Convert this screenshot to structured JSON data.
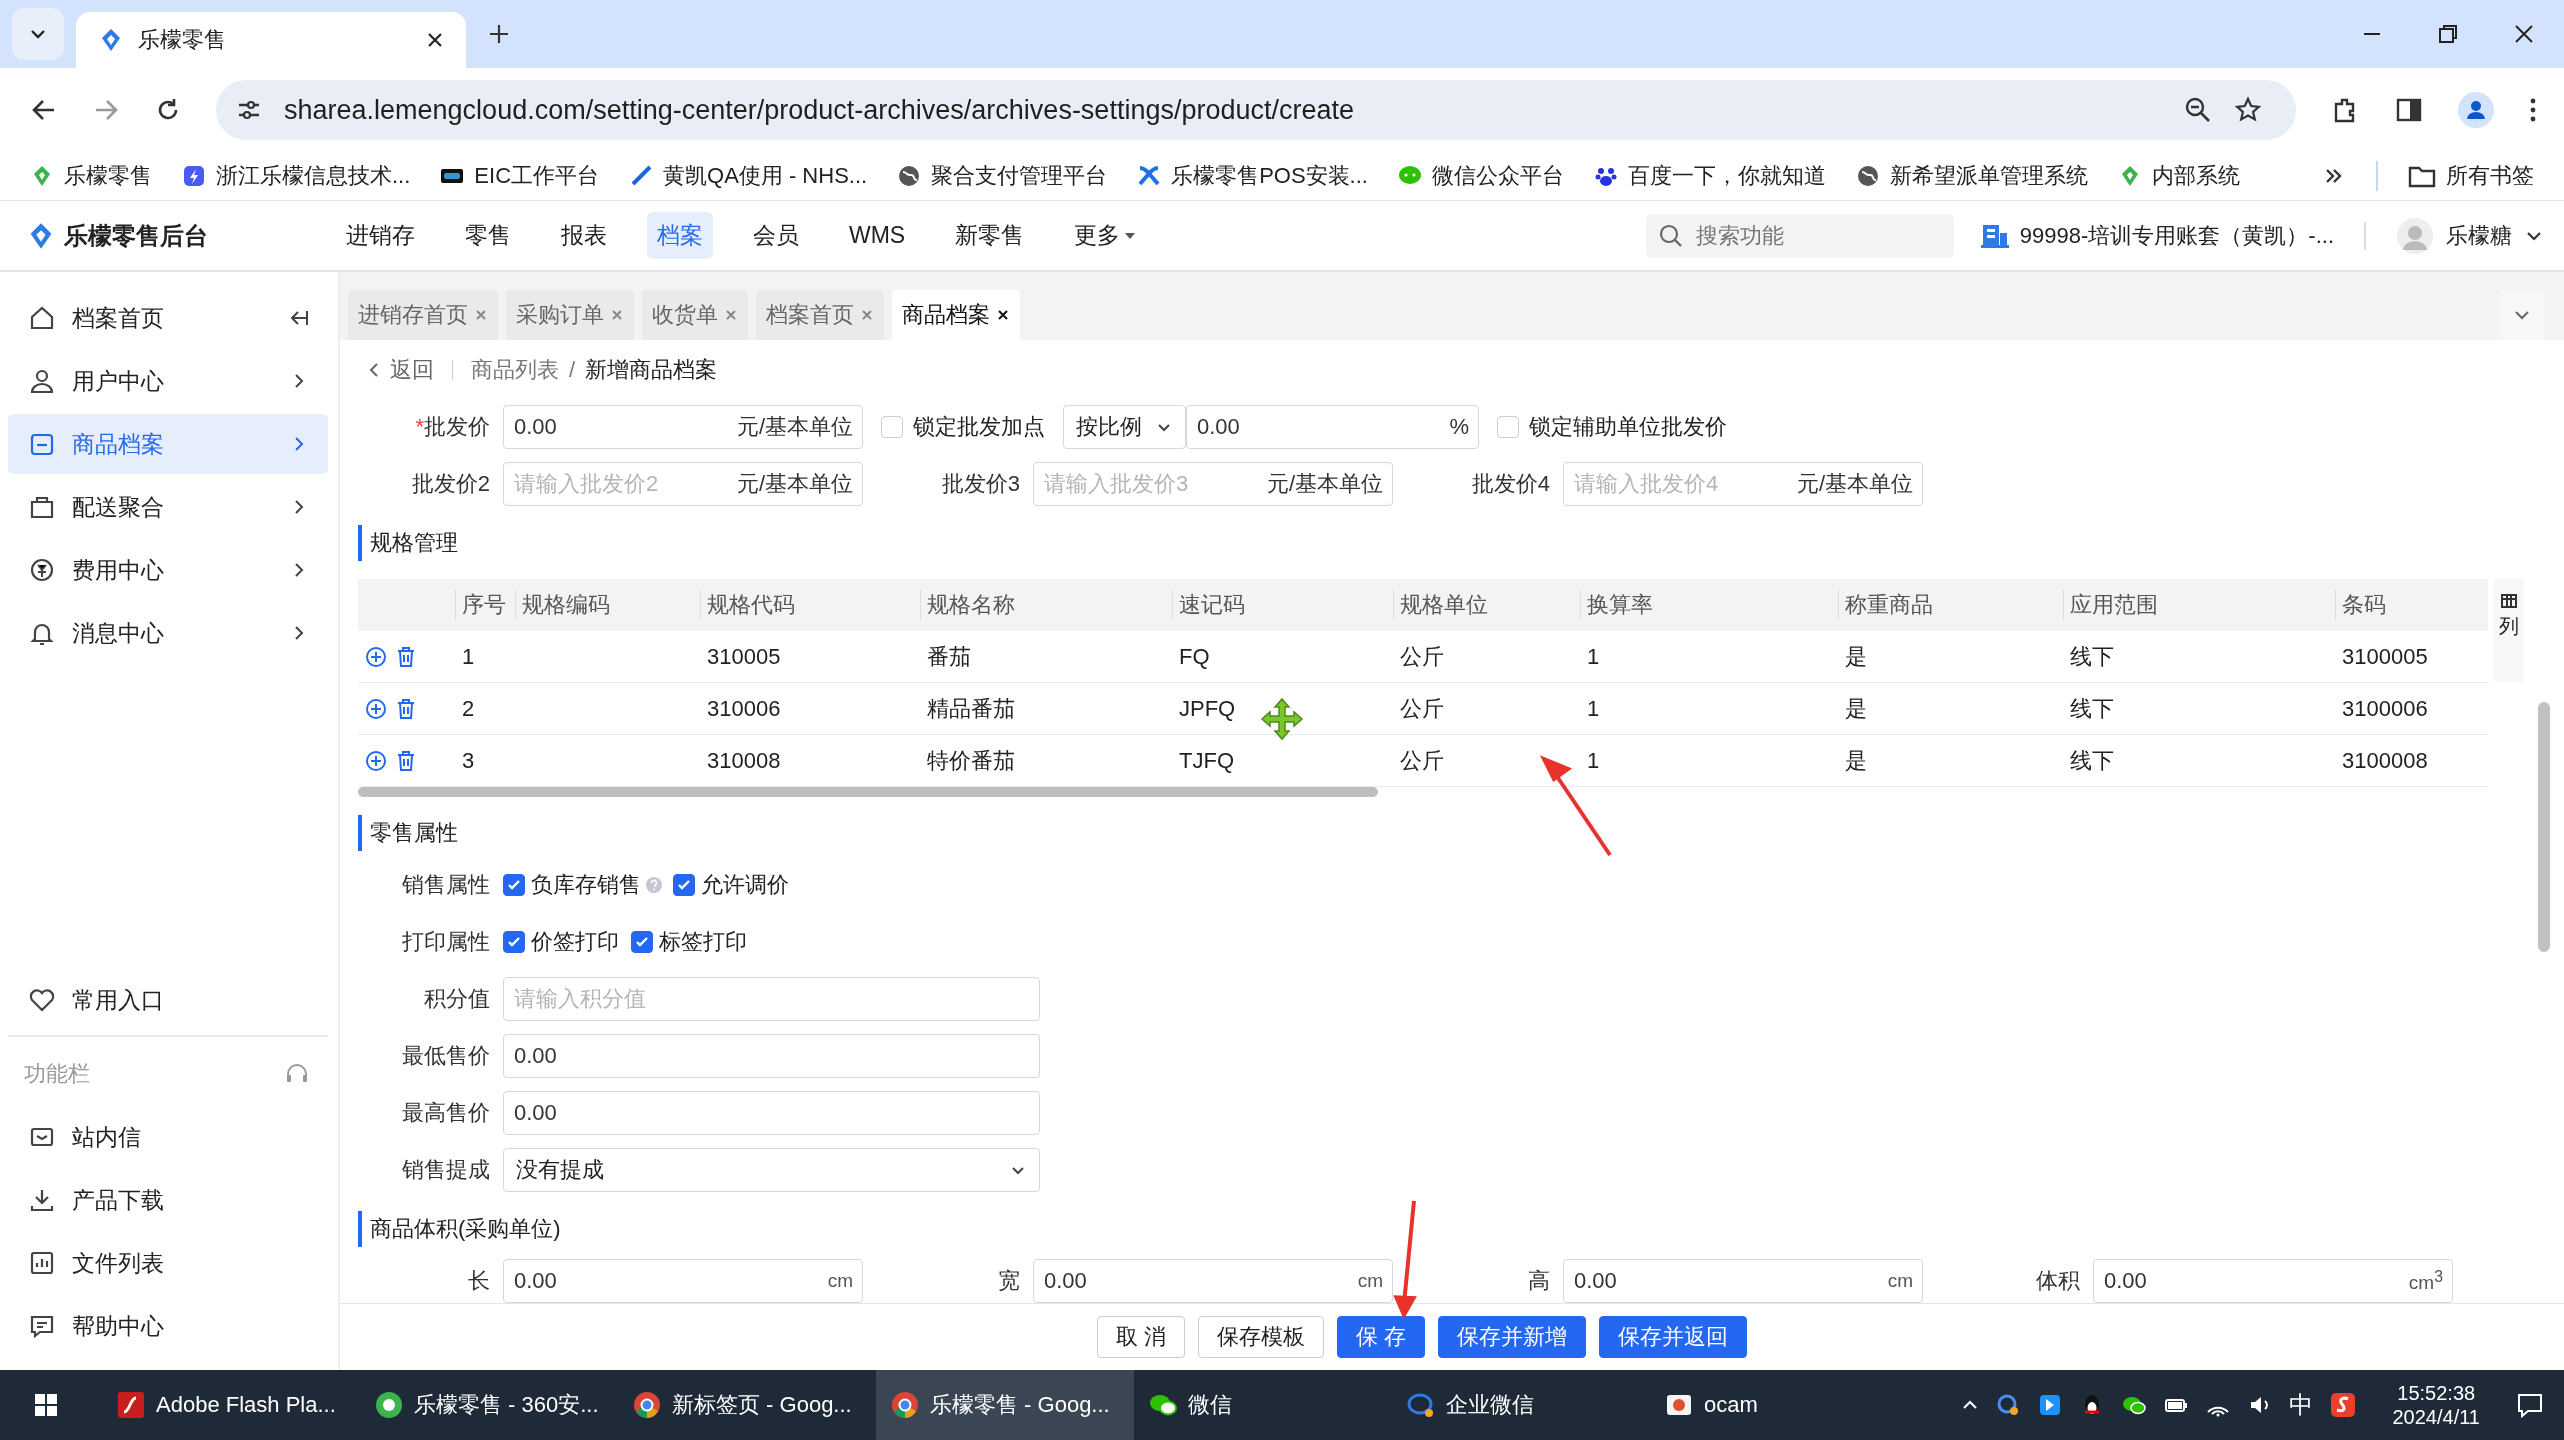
{
  "browser": {
    "tab": {
      "title": "乐檬零售"
    },
    "url": "sharea.lemengcloud.com/setting-center/product-archives/archives-settings/product/create",
    "bookmarks": [
      {
        "label": "乐檬零售"
      },
      {
        "label": "浙江乐檬信息技术..."
      },
      {
        "label": "EIC工作平台"
      },
      {
        "label": "黄凯QA使用 - NHS..."
      },
      {
        "label": "聚合支付管理平台"
      },
      {
        "label": "乐檬零售POS安装..."
      },
      {
        "label": "微信公众平台"
      },
      {
        "label": "百度一下，你就知道"
      },
      {
        "label": "新希望派单管理系统"
      },
      {
        "label": "内部系统"
      }
    ],
    "all_bookmarks": "所有书签"
  },
  "app": {
    "title": "乐檬零售后台",
    "nav": [
      {
        "label": "进销存",
        "selected": false
      },
      {
        "label": "零售",
        "selected": false
      },
      {
        "label": "报表",
        "selected": false
      },
      {
        "label": "档案",
        "selected": true
      },
      {
        "label": "会员",
        "selected": false
      },
      {
        "label": "WMS",
        "selected": false
      },
      {
        "label": "新零售",
        "selected": false
      },
      {
        "label": "更多",
        "selected": false,
        "dropdown": true
      }
    ],
    "search": {
      "placeholder": "搜索功能"
    },
    "account": "99998-培训专用账套（黄凯）-...",
    "user": "乐檬糖"
  },
  "sidebar": {
    "items": [
      {
        "label": "档案首页",
        "selected": false
      },
      {
        "label": "用户中心",
        "selected": false
      },
      {
        "label": "商品档案",
        "selected": true
      },
      {
        "label": "配送聚合",
        "selected": false
      },
      {
        "label": "费用中心",
        "selected": false
      },
      {
        "label": "消息中心",
        "selected": false
      }
    ],
    "favorites": {
      "label": "常用入口"
    },
    "tools_title": "功能栏",
    "tools": [
      {
        "label": "站内信"
      },
      {
        "label": "产品下载"
      },
      {
        "label": "文件列表"
      },
      {
        "label": "帮助中心"
      }
    ]
  },
  "page_tabs": [
    {
      "label": "进销存首页",
      "selected": false
    },
    {
      "label": "采购订单",
      "selected": false
    },
    {
      "label": "收货单",
      "selected": false
    },
    {
      "label": "档案首页",
      "selected": false
    },
    {
      "label": "商品档案",
      "selected": true
    }
  ],
  "breadcrumb": {
    "back": "返回",
    "items": [
      "商品列表",
      "新增商品档案"
    ],
    "separator": "/"
  },
  "price_rows": [
    [
      {
        "kind": "field",
        "required_mark": "*",
        "label": "批发价",
        "value": "0.00",
        "suffix": "元/基本单位"
      },
      {
        "kind": "checkbox",
        "label": "锁定批发加点",
        "checked": false
      },
      {
        "kind": "select",
        "value": "按比例"
      },
      {
        "kind": "field",
        "value": "0.00",
        "suffix": "%"
      },
      {
        "kind": "checkbox",
        "label": "锁定辅助单位批发价",
        "checked": false
      }
    ],
    [
      {
        "kind": "field",
        "label": "批发价2",
        "placeholder": "请输入批发价2",
        "suffix": "元/基本单位"
      },
      {
        "kind": "field",
        "label": "批发价3",
        "placeholder": "请输入批发价3",
        "suffix": "元/基本单位"
      },
      {
        "kind": "field",
        "label": "批发价4",
        "placeholder": "请输入批发价4",
        "suffix": "元/基本单位"
      }
    ]
  ],
  "spec": {
    "title": "规格管理",
    "columns": [
      "序号",
      "规格编码",
      "规格代码",
      "规格名称",
      "速记码",
      "规格单位",
      "换算率",
      "称重商品",
      "应用范围",
      "条码"
    ],
    "column_settings": "列",
    "rows": [
      {
        "no": "1",
        "code": "310005",
        "name": "番茄",
        "mnemonic": "FQ",
        "unit": "公斤",
        "rate": "1",
        "weighed": "是",
        "scope": "线下",
        "barcode": "3100005"
      },
      {
        "no": "2",
        "code": "310006",
        "name": "精品番茄",
        "mnemonic": "JPFQ",
        "unit": "公斤",
        "rate": "1",
        "weighed": "是",
        "scope": "线下",
        "barcode": "3100006"
      },
      {
        "no": "3",
        "code": "310008",
        "name": "特价番茄",
        "mnemonic": "TJFQ",
        "unit": "公斤",
        "rate": "1",
        "weighed": "是",
        "scope": "线下",
        "barcode": "3100008"
      }
    ]
  },
  "retail": {
    "title": "零售属性",
    "rows": [
      {
        "kind": "checks",
        "label": "销售属性",
        "options": [
          {
            "label": "负库存销售",
            "checked": true,
            "hint": true
          },
          {
            "label": "允许调价",
            "checked": true,
            "hint": false
          }
        ]
      },
      {
        "kind": "checks",
        "label": "打印属性",
        "options": [
          {
            "label": "价签打印",
            "checked": true,
            "hint": false
          },
          {
            "label": "标签打印",
            "checked": true,
            "hint": false
          }
        ]
      },
      {
        "kind": "field",
        "label": "积分值",
        "placeholder": "请输入积分值"
      },
      {
        "kind": "field",
        "label": "最低售价",
        "value": "0.00"
      },
      {
        "kind": "field",
        "label": "最高售价",
        "value": "0.00"
      },
      {
        "kind": "select",
        "label": "销售提成",
        "value": "没有提成"
      }
    ]
  },
  "volume": {
    "title": "商品体积(采购单位)",
    "fields": [
      {
        "label": "长",
        "value": "0.00",
        "suffix": "cm"
      },
      {
        "label": "宽",
        "value": "0.00",
        "suffix": "cm"
      },
      {
        "label": "高",
        "value": "0.00",
        "suffix": "cm"
      },
      {
        "label": "体积",
        "value": "0.00",
        "suffix": "cm$^{3}$"
      }
    ]
  },
  "footer_buttons": [
    {
      "label": "取 消",
      "primary": false
    },
    {
      "label": "保存模板",
      "primary": false
    },
    {
      "label": "保 存",
      "primary": true
    },
    {
      "label": "保存并新增",
      "primary": true
    },
    {
      "label": "保存并返回",
      "primary": true
    }
  ],
  "taskbar": {
    "apps": [
      {
        "label": "Adobe Flash Pla...",
        "selected": false
      },
      {
        "label": "乐檬零售 - 360安...",
        "selected": false
      },
      {
        "label": "新标签页 - Goog...",
        "selected": false
      },
      {
        "label": "乐檬零售 - Goog...",
        "selected": true
      },
      {
        "label": "微信",
        "selected": false
      },
      {
        "label": "企业微信",
        "selected": false
      },
      {
        "label": "ocam",
        "selected": false
      }
    ],
    "ime": "中",
    "time": "15:52:38",
    "date": "2024/4/11"
  }
}
